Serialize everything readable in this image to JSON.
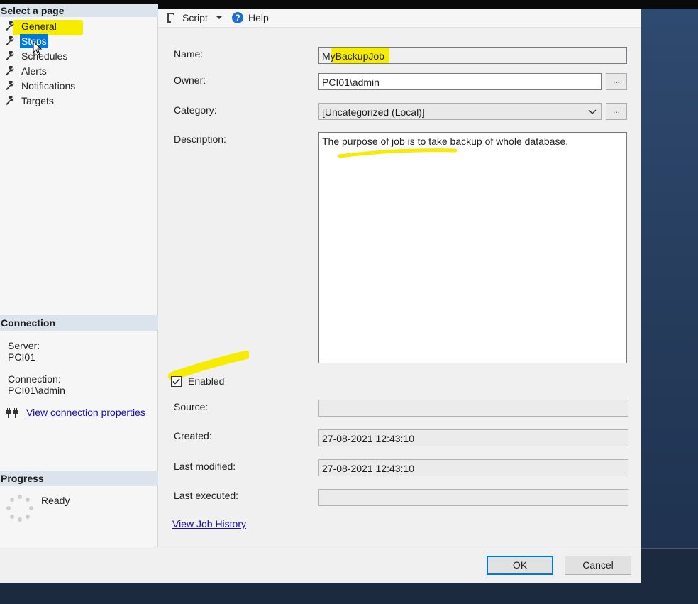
{
  "left_panel": {
    "header": "Select a page",
    "items": [
      {
        "label": "General"
      },
      {
        "label": "Steps"
      },
      {
        "label": "Schedules"
      },
      {
        "label": "Alerts"
      },
      {
        "label": "Notifications"
      },
      {
        "label": "Targets"
      }
    ],
    "connection": {
      "title": "Connection",
      "server_label": "Server:",
      "server_value": "PCI01",
      "connection_label": "Connection:",
      "connection_value": "PCI01\\admin",
      "link": "View connection properties"
    },
    "progress": {
      "title": "Progress",
      "status": "Ready"
    }
  },
  "toolbar": {
    "script_label": "Script",
    "help_label": "Help"
  },
  "form": {
    "name_label": "Name:",
    "name_value": "MyBackupJob",
    "owner_label": "Owner:",
    "owner_value": "PCI01\\admin",
    "category_label": "Category:",
    "category_value": "[Uncategorized (Local)]",
    "description_label": "Description:",
    "description_value": "The purpose of job is to take backup of whole database.",
    "enabled_label": "Enabled",
    "enabled_checked": true,
    "source_label": "Source:",
    "source_value": "",
    "created_label": "Created:",
    "created_value": "27-08-2021 12:43:10",
    "modified_label": "Last modified:",
    "modified_value": "27-08-2021 12:43:10",
    "executed_label": "Last executed:",
    "executed_value": "",
    "history_link": "View Job History",
    "ellipsis": "..."
  },
  "buttons": {
    "ok": "OK",
    "cancel": "Cancel"
  },
  "colors": {
    "highlight": "#f5ec00",
    "selection": "#0078d7",
    "link": "#1a0dab"
  }
}
